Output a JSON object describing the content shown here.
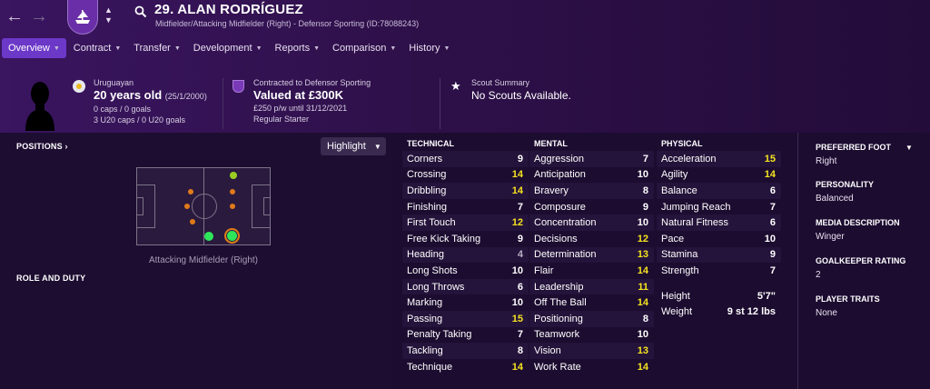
{
  "header": {
    "player_title": "29. ALAN RODRÍGUEZ",
    "subtitle": "Midfielder/Attacking Midfielder (Right) - Defensor Sporting (ID:78088243)"
  },
  "tabs": [
    {
      "label": "Overview"
    },
    {
      "label": "Contract"
    },
    {
      "label": "Transfer"
    },
    {
      "label": "Development"
    },
    {
      "label": "Reports"
    },
    {
      "label": "Comparison"
    },
    {
      "label": "History"
    }
  ],
  "info": {
    "nationality": "Uruguayan",
    "age": "20 years old",
    "dob": "(25/1/2000)",
    "caps": "0 caps / 0 goals",
    "u20_caps": "3 U20 caps / 0 U20 goals",
    "contract_label": "Contracted to Defensor Sporting",
    "value": "Valued at £300K",
    "wage": "£250 p/w until 31/12/2021",
    "status": "Regular Starter",
    "scout_label": "Scout Summary",
    "scout_text": "No Scouts Available."
  },
  "positions": {
    "header": "POSITIONS",
    "position_label": "Attacking Midfielder (Right)",
    "role_header": "ROLE AND DUTY",
    "highlight_label": "Highlight"
  },
  "technical": {
    "header": "TECHNICAL",
    "rows": [
      {
        "name": "Corners",
        "value": "9"
      },
      {
        "name": "Crossing",
        "value": "14"
      },
      {
        "name": "Dribbling",
        "value": "14"
      },
      {
        "name": "Finishing",
        "value": "7"
      },
      {
        "name": "First Touch",
        "value": "12"
      },
      {
        "name": "Free Kick Taking",
        "value": "9"
      },
      {
        "name": "Heading",
        "value": "4"
      },
      {
        "name": "Long Shots",
        "value": "10"
      },
      {
        "name": "Long Throws",
        "value": "6"
      },
      {
        "name": "Marking",
        "value": "10"
      },
      {
        "name": "Passing",
        "value": "15"
      },
      {
        "name": "Penalty Taking",
        "value": "7"
      },
      {
        "name": "Tackling",
        "value": "8"
      },
      {
        "name": "Technique",
        "value": "14"
      }
    ]
  },
  "mental": {
    "header": "MENTAL",
    "rows": [
      {
        "name": "Aggression",
        "value": "7"
      },
      {
        "name": "Anticipation",
        "value": "10"
      },
      {
        "name": "Bravery",
        "value": "8"
      },
      {
        "name": "Composure",
        "value": "9"
      },
      {
        "name": "Concentration",
        "value": "10"
      },
      {
        "name": "Decisions",
        "value": "12"
      },
      {
        "name": "Determination",
        "value": "13"
      },
      {
        "name": "Flair",
        "value": "14"
      },
      {
        "name": "Leadership",
        "value": "11"
      },
      {
        "name": "Off The Ball",
        "value": "14"
      },
      {
        "name": "Positioning",
        "value": "8"
      },
      {
        "name": "Teamwork",
        "value": "10"
      },
      {
        "name": "Vision",
        "value": "13"
      },
      {
        "name": "Work Rate",
        "value": "14"
      }
    ]
  },
  "physical": {
    "header": "PHYSICAL",
    "rows": [
      {
        "name": "Acceleration",
        "value": "15"
      },
      {
        "name": "Agility",
        "value": "14"
      },
      {
        "name": "Balance",
        "value": "6"
      },
      {
        "name": "Jumping Reach",
        "value": "7"
      },
      {
        "name": "Natural Fitness",
        "value": "6"
      },
      {
        "name": "Pace",
        "value": "10"
      },
      {
        "name": "Stamina",
        "value": "9"
      },
      {
        "name": "Strength",
        "value": "7"
      }
    ],
    "height_label": "Height",
    "height_value": "5'7\"",
    "weight_label": "Weight",
    "weight_value": "9 st 12 lbs"
  },
  "sidebar": {
    "preferred_foot_label": "PREFERRED FOOT",
    "preferred_foot": "Right",
    "personality_label": "PERSONALITY",
    "personality": "Balanced",
    "media_label": "MEDIA DESCRIPTION",
    "media": "Winger",
    "gk_label": "GOALKEEPER RATING",
    "gk": "2",
    "traits_label": "PLAYER TRAITS",
    "traits": "None"
  },
  "colors": {
    "accent": "#6b38c8",
    "value_high": "#f5e320",
    "value_low": "#b8b0c4",
    "natural_position": "#2ee65a",
    "accomplished_position": "#9acd20",
    "unconvincing_position": "#e07a1a"
  }
}
